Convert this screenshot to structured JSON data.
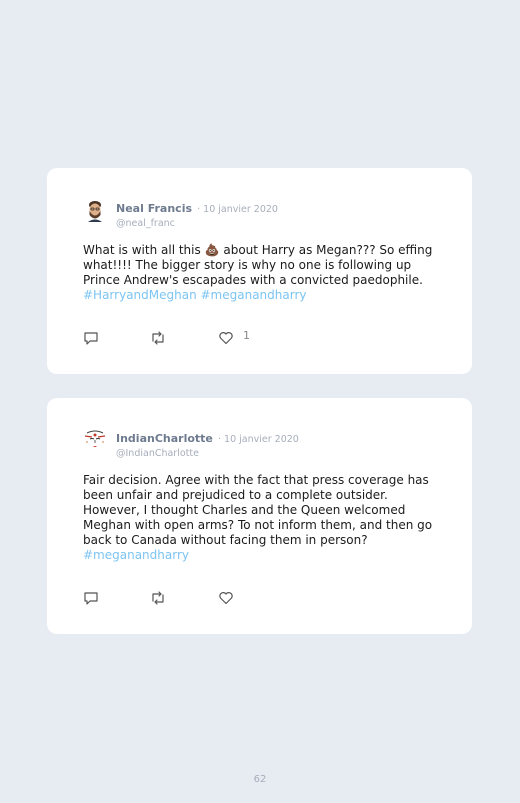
{
  "tweets": [
    {
      "name": "Neal Francis",
      "date": "· 10 janvier 2020",
      "handle": "@neal_franc",
      "text_a": "What is with all this ",
      "emoji": "💩",
      "text_b": " about Harry as Megan??? So effing what!!!! The bigger story is why no one is following up Prince Andrew's escapades with a convicted paedophile.",
      "hashtags": "#HarryandMeghan #meganandharry",
      "like_count": "1"
    },
    {
      "name": "IndianCharlotte",
      "date": "· 10 janvier 2020",
      "handle": "@IndianCharlotte",
      "text": "Fair decision. Agree with the fact that press coverage has been unfair and prejudiced to a complete outsider. However, I thought Charles and the Queen welcomed Meghan with open arms? To not inform them, and then go back to Canada without facing them in person?",
      "hashtags": "#meganandharry"
    }
  ],
  "page_number": "62",
  "colors": {
    "hashtag": "#7cc4f2",
    "background": "#e7ebf2"
  },
  "icons": [
    "reply-icon",
    "retweet-icon",
    "like-icon"
  ]
}
